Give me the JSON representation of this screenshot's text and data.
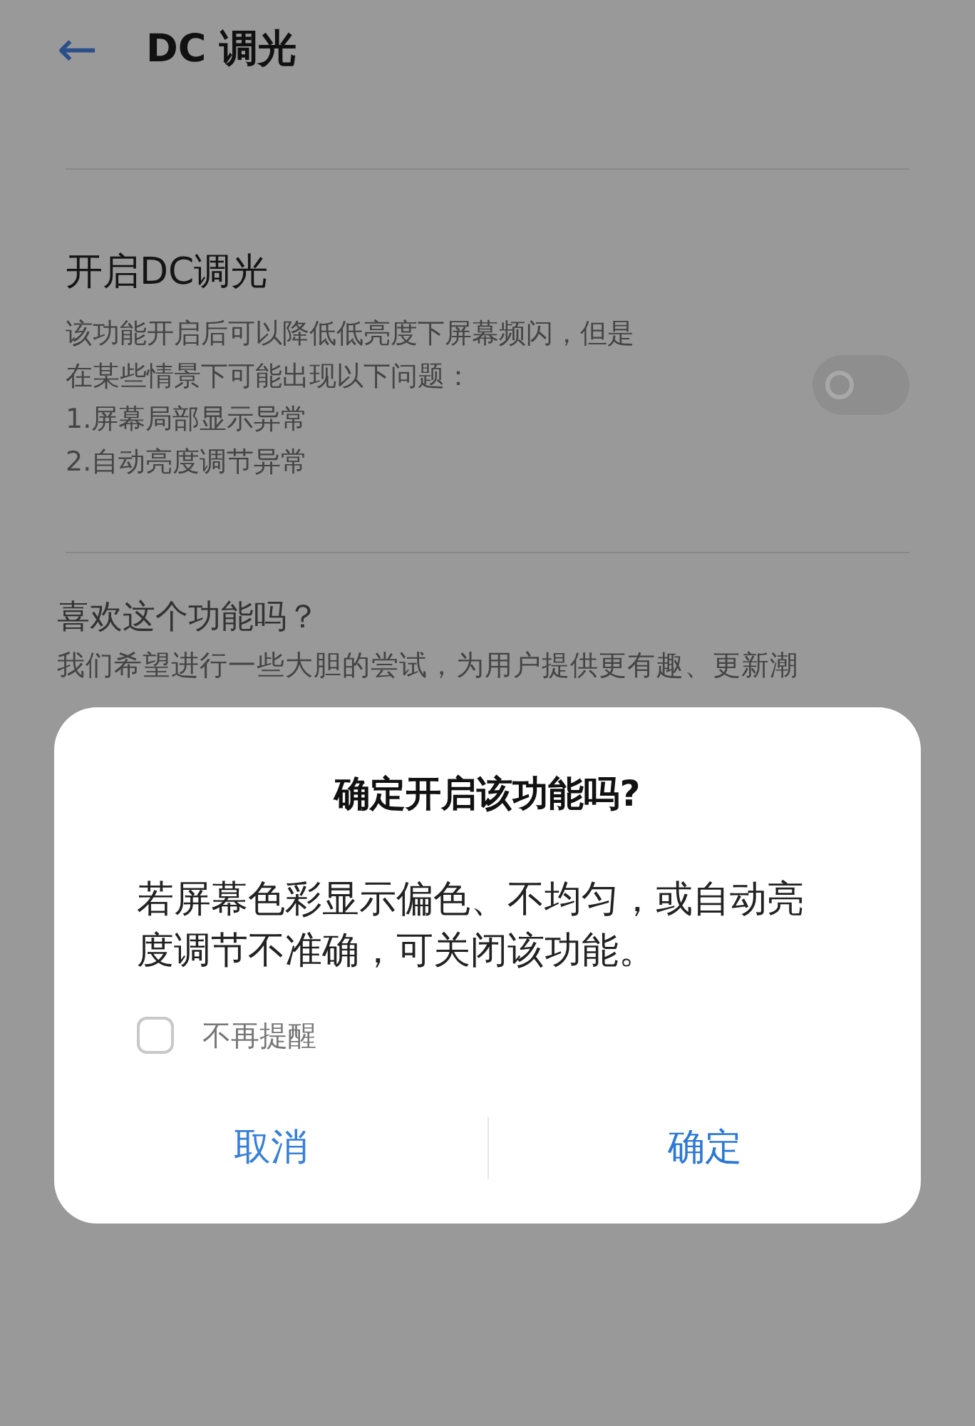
{
  "header": {
    "back": "←",
    "title": "DC 调光"
  },
  "setting": {
    "title": "开启DC调光",
    "lines": [
      "该功能开启后可以降低低亮度下屏幕频闪，但是",
      "在某些情景下可能出现以下问题：",
      "1.屏幕局部显示异常",
      "2.自动亮度调节异常"
    ],
    "on": false
  },
  "feedback": {
    "title": "喜欢这个功能吗？",
    "lines": [
      "我们希望进行一些大胆的尝试，为用户提供更有趣、更新潮"
    ]
  },
  "dialog": {
    "title": "确定开启该功能吗?",
    "message": "若屏幕色彩显示偏色、不均匀，或自动亮度调节不准确，可关闭该功能。",
    "checkbox": {
      "label": "不再提醒",
      "checked": false
    },
    "buttons": [
      {
        "label": "取消",
        "kind": "cancel"
      },
      {
        "label": "确定",
        "kind": "confirm"
      }
    ]
  }
}
